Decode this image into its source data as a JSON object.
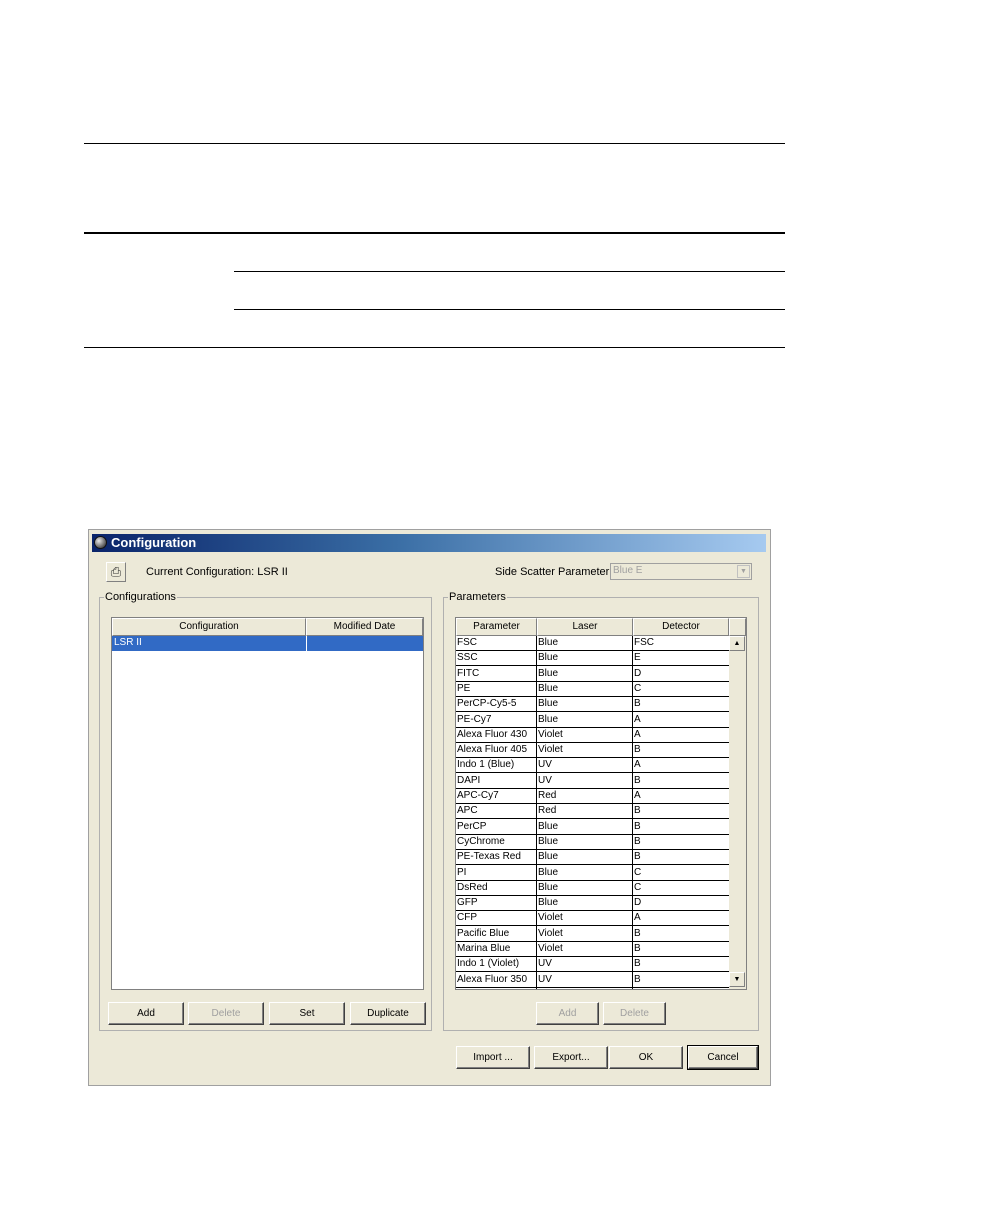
{
  "window": {
    "title": "Configuration"
  },
  "header": {
    "current_configuration_label": "Current Configuration:  LSR II",
    "side_scatter_label": "Side Scatter Parameter:",
    "side_scatter_value": "Blue E"
  },
  "configurations": {
    "legend": "Configurations",
    "columns": [
      "Configuration",
      "Modified Date"
    ],
    "rows": [
      {
        "name": "LSR II",
        "date": ""
      }
    ],
    "buttons": {
      "add": "Add",
      "delete": "Delete",
      "set": "Set",
      "duplicate": "Duplicate"
    }
  },
  "parameters": {
    "legend": "Parameters",
    "columns": [
      "Parameter",
      "Laser",
      "Detector"
    ],
    "rows": [
      [
        "FSC",
        "Blue",
        "FSC"
      ],
      [
        "SSC",
        "Blue",
        "E"
      ],
      [
        "FITC",
        "Blue",
        "D"
      ],
      [
        "PE",
        "Blue",
        "C"
      ],
      [
        "PerCP-Cy5-5",
        "Blue",
        "B"
      ],
      [
        "PE-Cy7",
        "Blue",
        "A"
      ],
      [
        "Alexa Fluor 430",
        "Violet",
        "A"
      ],
      [
        "Alexa Fluor 405",
        "Violet",
        "B"
      ],
      [
        "Indo 1 (Blue)",
        "UV",
        "A"
      ],
      [
        "DAPI",
        "UV",
        "B"
      ],
      [
        "APC-Cy7",
        "Red",
        "A"
      ],
      [
        "APC",
        "Red",
        "B"
      ],
      [
        "PerCP",
        "Blue",
        "B"
      ],
      [
        "CyChrome",
        "Blue",
        "B"
      ],
      [
        "PE-Texas Red",
        "Blue",
        "B"
      ],
      [
        "PI",
        "Blue",
        "C"
      ],
      [
        "DsRed",
        "Blue",
        "C"
      ],
      [
        "GFP",
        "Blue",
        "D"
      ],
      [
        "CFP",
        "Violet",
        "A"
      ],
      [
        "Pacific Blue",
        "Violet",
        "B"
      ],
      [
        "Marina Blue",
        "Violet",
        "B"
      ],
      [
        "Indo 1 (Violet)",
        "UV",
        "B"
      ],
      [
        "Alexa Fluor 350",
        "UV",
        "B"
      ]
    ],
    "buttons": {
      "add": "Add",
      "delete": "Delete"
    }
  },
  "footer": {
    "import": "Import ...",
    "export": "Export...",
    "ok": "OK",
    "cancel": "Cancel"
  },
  "icons": {
    "title": "app-globe-icon",
    "print": "printer-icon",
    "dropdown": "chevron-down-icon",
    "scroll_up": "scroll-up-arrow-icon",
    "scroll_down": "scroll-down-arrow-icon"
  },
  "colors": {
    "selection": "#316ac5",
    "titlebar_start": "#0a246a",
    "titlebar_end": "#a6caf0",
    "window_bg": "#ece9d8"
  }
}
